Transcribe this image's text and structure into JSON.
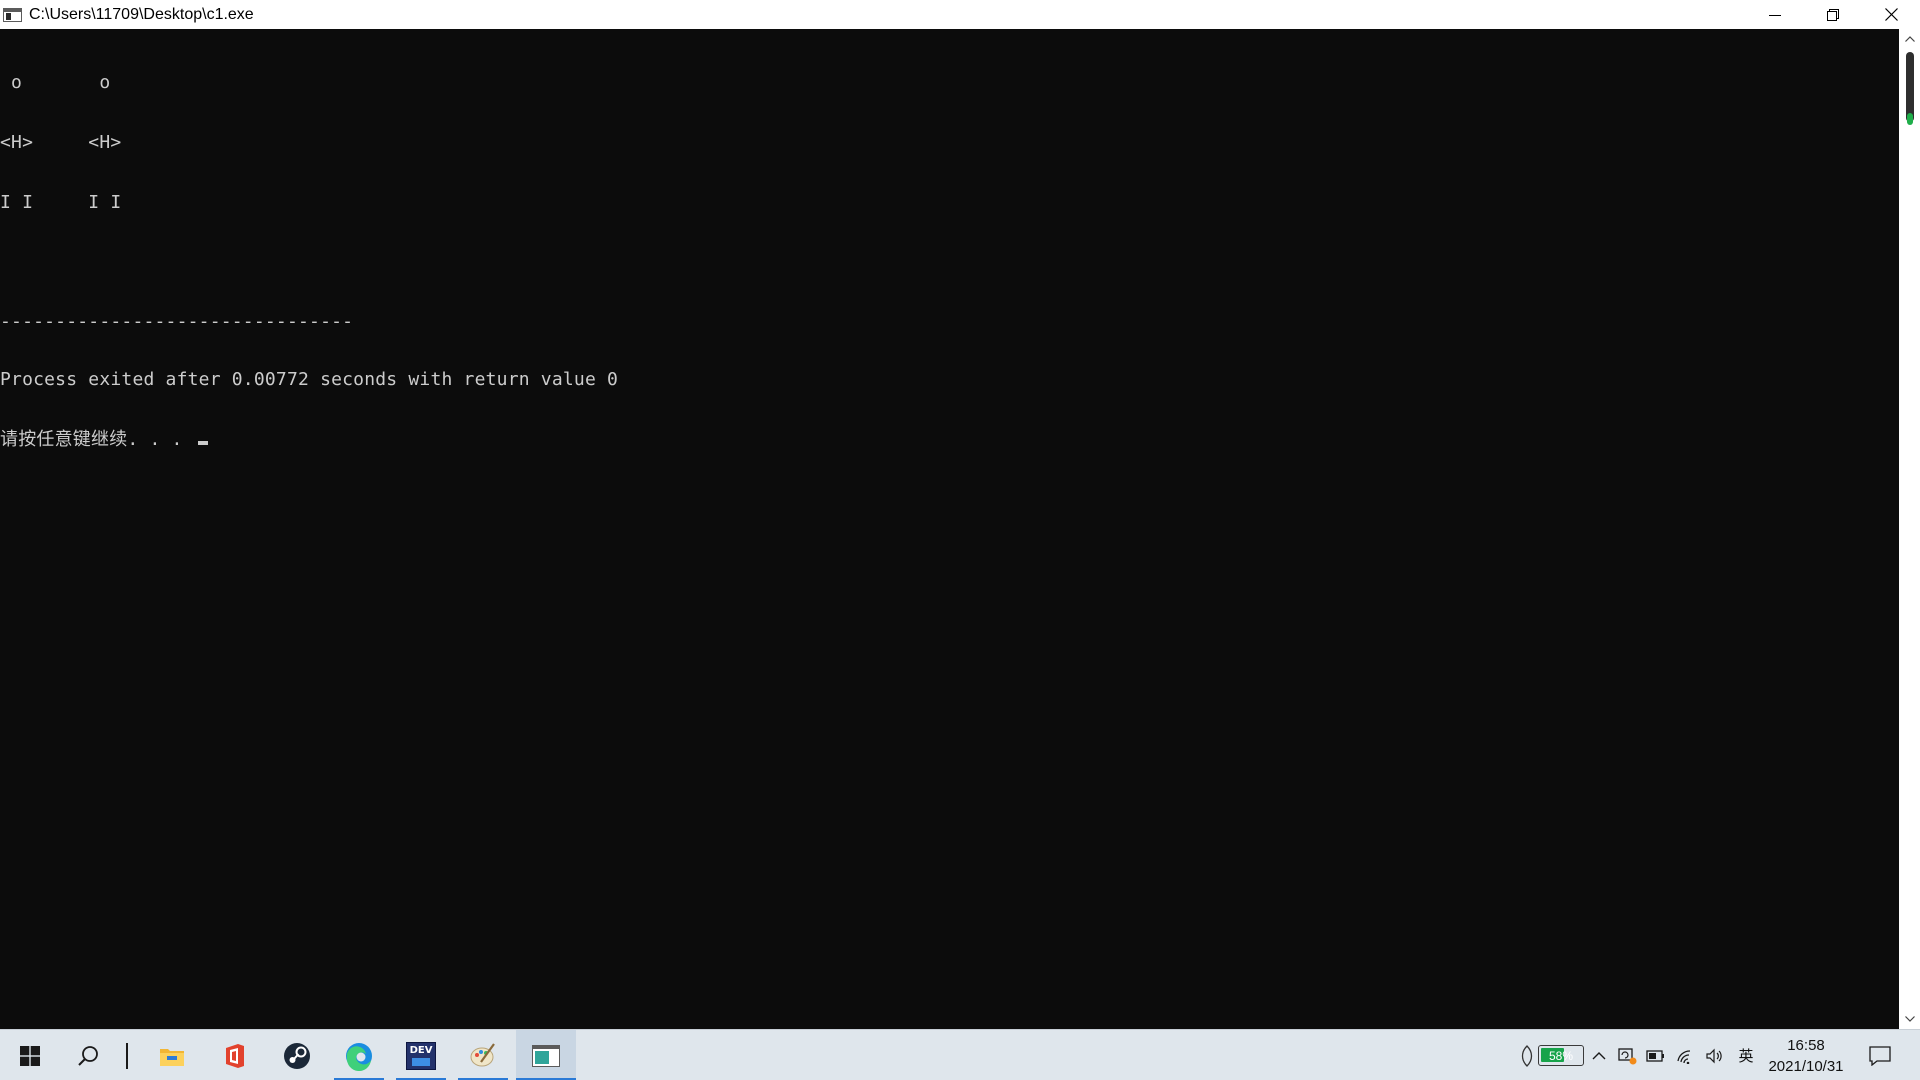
{
  "window": {
    "title": "C:\\Users\\11709\\Desktop\\c1.exe"
  },
  "console": {
    "lines": [
      " o       o",
      "<H>     <H>",
      "I I     I I",
      "",
      "--------------------------------",
      "Process exited after 0.00772 seconds with return value 0",
      "请按任意键继续. . . "
    ]
  },
  "taskbar": {
    "apps": [
      {
        "name": "start-button",
        "icon": "windows-logo-icon"
      },
      {
        "name": "search-button",
        "icon": "search-icon"
      },
      {
        "name": "file-explorer",
        "icon": "folder-icon"
      },
      {
        "name": "office",
        "icon": "office-icon"
      },
      {
        "name": "steam",
        "icon": "steam-icon"
      },
      {
        "name": "edge",
        "icon": "edge-icon"
      },
      {
        "name": "dev-cpp",
        "icon": "devcpp-icon",
        "label": "DEV"
      },
      {
        "name": "paint",
        "icon": "paint-icon"
      },
      {
        "name": "console-window",
        "icon": "console-icon"
      }
    ],
    "tray": {
      "battery_percent_label": "58%",
      "battery_level": 0.58,
      "input_method": "英",
      "time": "16:58",
      "date": "2021/10/31"
    }
  },
  "colors": {
    "console_bg": "#0c0c0c",
    "console_fg": "#cccccc",
    "taskbar_bg": "#dfe6ec",
    "active_underline": "#2a7ad6",
    "battery_green": "#17a34a"
  }
}
